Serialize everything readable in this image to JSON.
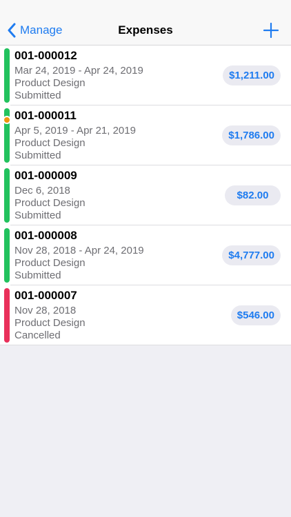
{
  "nav": {
    "back_label": "Manage",
    "title": "Expenses",
    "add_icon": "plus-icon",
    "back_icon": "chevron-left-icon"
  },
  "colors": {
    "accent": "#1f7cf0",
    "submitted": "#22c25e",
    "pending": "#f0960e",
    "cancelled": "#e9305a"
  },
  "expenses": [
    {
      "id": "001-000012",
      "date": "Mar 24, 2019 - Apr 24, 2019",
      "project": "Product Design",
      "status": "Submitted",
      "amount": "$1,211.00",
      "status_color": "submitted",
      "indicator": null
    },
    {
      "id": "001-000011",
      "date": "Apr 5, 2019 - Apr 21, 2019",
      "project": "Product Design",
      "status": "Submitted",
      "amount": "$1,786.00",
      "status_color": "submitted",
      "indicator": "pending"
    },
    {
      "id": "001-000009",
      "date": "Dec 6, 2018",
      "project": "Product Design",
      "status": "Submitted",
      "amount": "$82.00",
      "status_color": "submitted",
      "indicator": null
    },
    {
      "id": "001-000008",
      "date": "Nov 28, 2018 - Apr 24, 2019",
      "project": "Product Design",
      "status": "Submitted",
      "amount": "$4,777.00",
      "status_color": "submitted",
      "indicator": null
    },
    {
      "id": "001-000007",
      "date": "Nov 28, 2018",
      "project": "Product Design",
      "status": "Cancelled",
      "amount": "$546.00",
      "status_color": "cancelled",
      "indicator": null
    }
  ]
}
